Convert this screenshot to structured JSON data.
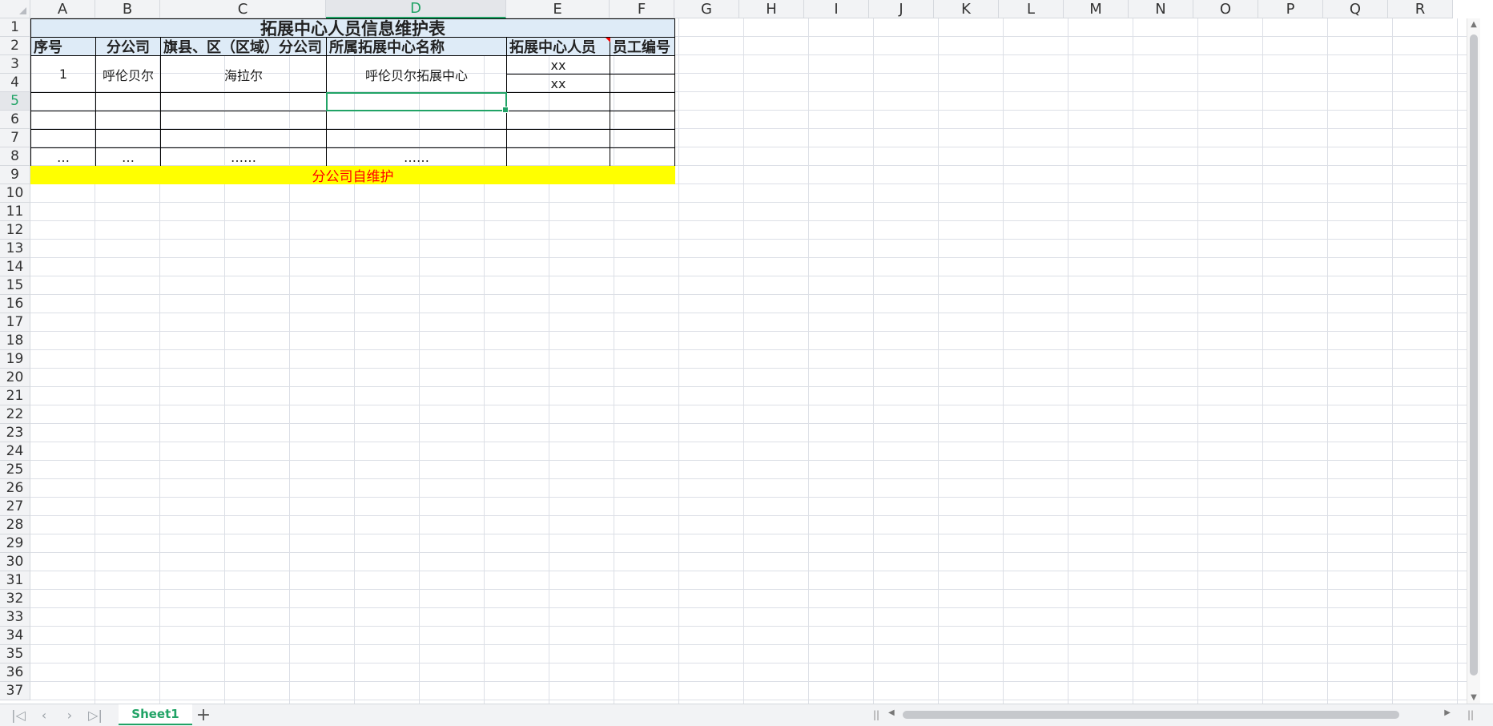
{
  "columns": [
    "A",
    "B",
    "C",
    "D",
    "E",
    "F",
    "G",
    "H",
    "I",
    "J",
    "K",
    "L",
    "M",
    "N",
    "O",
    "P",
    "Q",
    "R"
  ],
  "rows": [
    "1",
    "2",
    "3",
    "4",
    "5",
    "6",
    "7",
    "8",
    "9",
    "10",
    "11",
    "12",
    "13",
    "14",
    "15",
    "16",
    "17",
    "18",
    "19",
    "20",
    "21",
    "22",
    "23",
    "24",
    "25",
    "26",
    "27",
    "28",
    "29",
    "30",
    "31",
    "32",
    "33",
    "34",
    "35",
    "36",
    "37"
  ],
  "active_cell": {
    "column": "D",
    "row": "5"
  },
  "table": {
    "title": "拓展中心人员信息维护表",
    "headers": {
      "seq": "序号",
      "branch": "分公司",
      "county": "旗县、区（区域）分公司",
      "center_name": "所属拓展中心名称",
      "staff": "拓展中心人员",
      "emp_no": "员工编号"
    },
    "row1": {
      "seq": "1",
      "branch": "呼伦贝尔",
      "county": "海拉尔",
      "center_name": "呼伦贝尔拓展中心",
      "staff_a": "xx",
      "staff_b": "xx"
    },
    "ellipsis_row": {
      "seq": "…",
      "branch": "…",
      "county": "……",
      "center_name": "……"
    },
    "note": "分公司自维护"
  },
  "colors": {
    "accent": "#21a366",
    "header_fill": "#deebf7",
    "note_fill": "#ffff00",
    "note_text": "#ff0000"
  },
  "sheet_tabs": [
    {
      "label": "Sheet1",
      "active": true
    }
  ],
  "icons": {
    "first": "first-sheet-icon",
    "prev": "prev-sheet-icon",
    "next": "next-sheet-icon",
    "last": "last-sheet-icon",
    "add": "add-sheet-icon"
  }
}
